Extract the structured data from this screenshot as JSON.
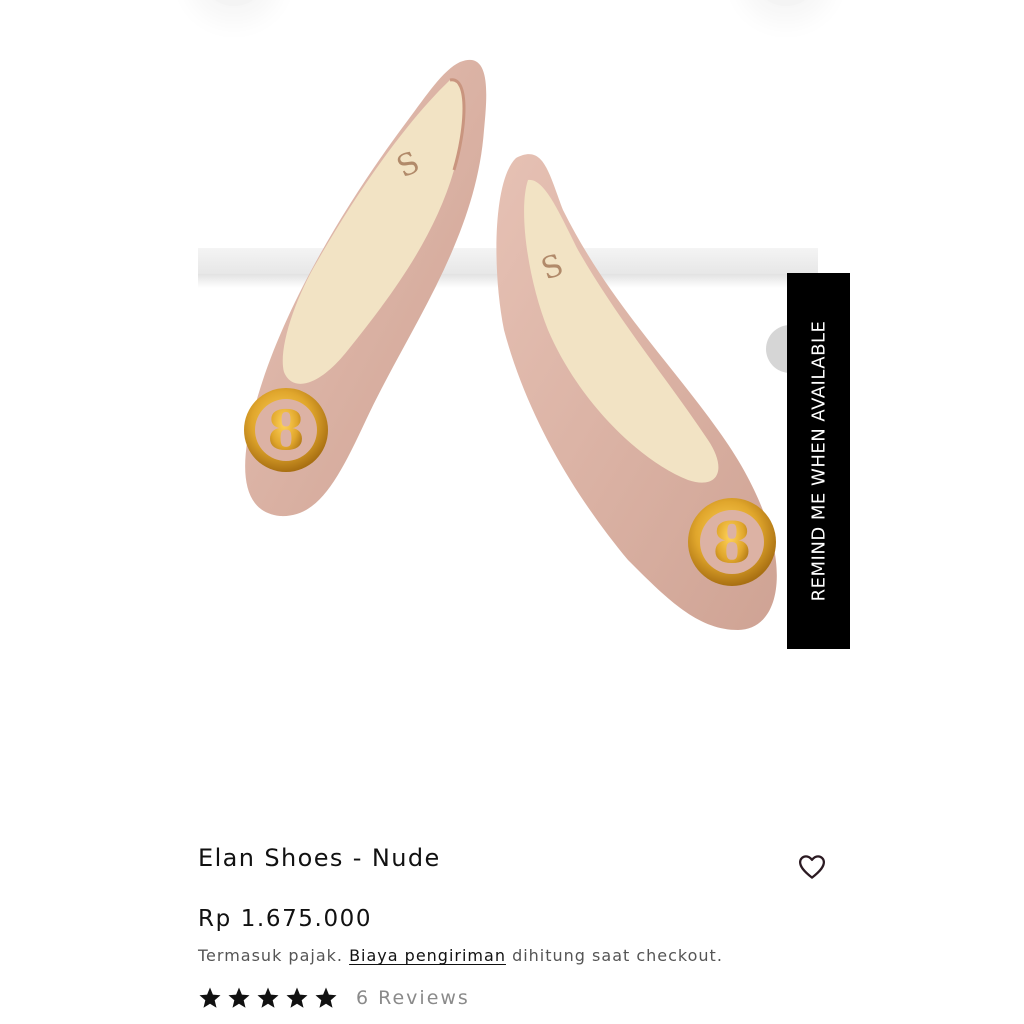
{
  "product": {
    "title": "Elan Shoes - Nude",
    "price": "Rp 1.675.000",
    "tax_prefix": "Termasuk pajak.",
    "shipping_link": "Biaya pengiriman",
    "tax_suffix": "dihitung saat checkout.",
    "rating": 5,
    "reviews_label": "6 Reviews"
  },
  "media": {
    "remind_label": "REMIND ME WHEN AVAILABLE",
    "shoe_color": "#dcb2a4",
    "buckle_color": "#e0a62c"
  },
  "icons": {
    "wishlist": "heart-outline-icon",
    "star": "star-icon"
  }
}
